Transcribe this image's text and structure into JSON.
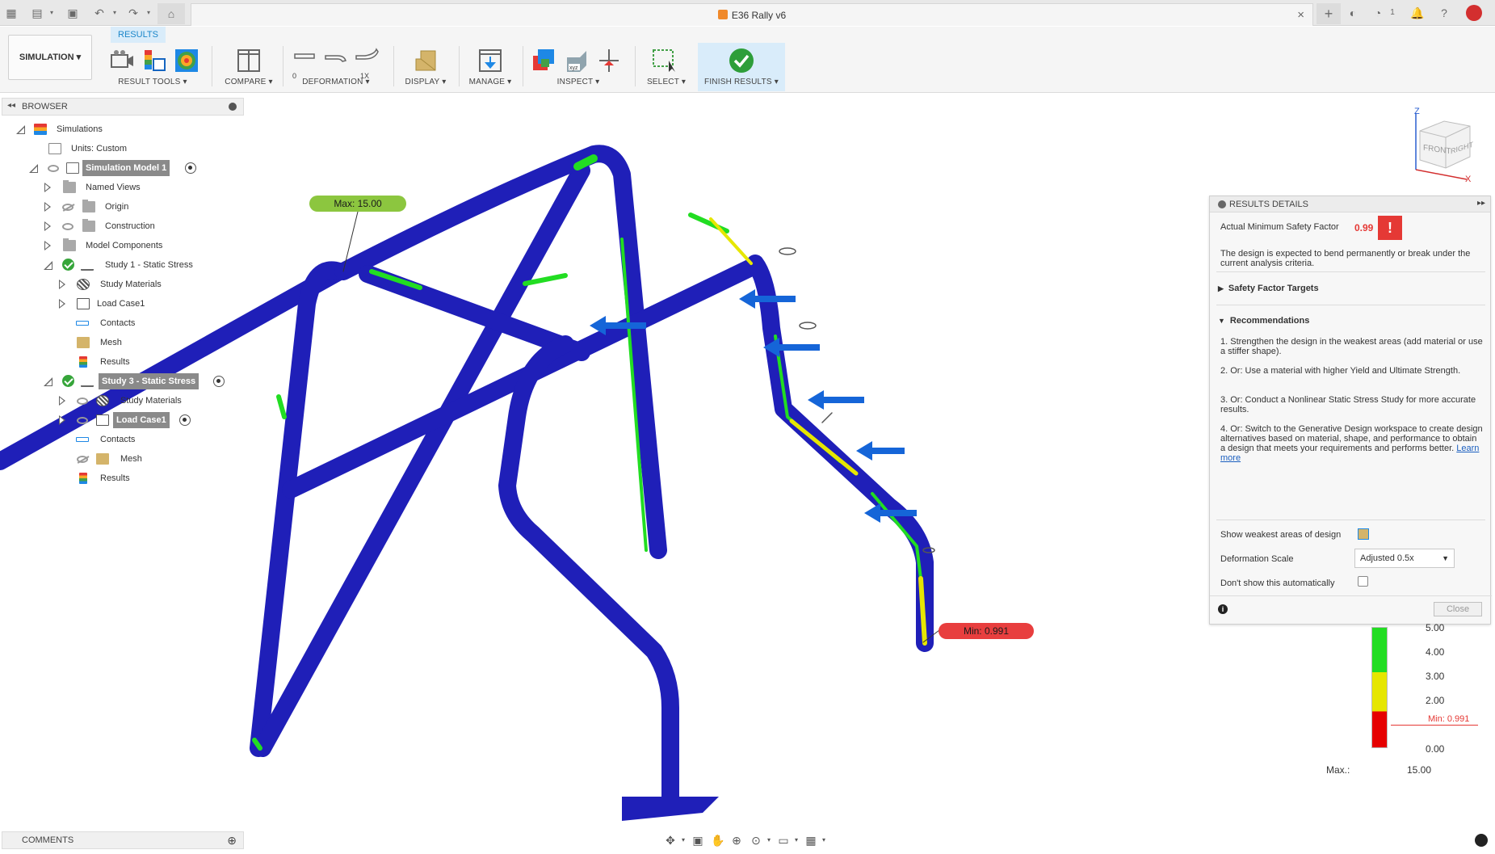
{
  "window": {
    "title": "E36 Rally v6",
    "notification_count": "1"
  },
  "toolbar": {
    "workspace": "SIMULATION",
    "active_tab": "RESULTS",
    "groups": {
      "result_tools": "RESULT TOOLS",
      "compare": "COMPARE",
      "deformation": "DEFORMATION",
      "display": "DISPLAY",
      "manage": "MANAGE",
      "inspect": "INSPECT",
      "select": "SELECT",
      "finish_results": "FINISH RESULTS"
    },
    "deformation_icon_labels": [
      "0",
      "1X"
    ]
  },
  "browser": {
    "title": "BROWSER",
    "items": {
      "simulations": "Simulations",
      "units": "Units: Custom",
      "model": "Simulation Model 1",
      "named_views": "Named Views",
      "origin": "Origin",
      "construction": "Construction",
      "model_components": "Model Components",
      "study1": "Study 1 - Static Stress",
      "study1_materials": "Study Materials",
      "study1_load": "Load Case1",
      "study1_contacts": "Contacts",
      "study1_mesh": "Mesh",
      "study1_results": "Results",
      "study3": "Study 3 - Static Stress",
      "study3_materials": "Study Materials",
      "study3_load": "Load Case1",
      "study3_contacts": "Contacts",
      "study3_mesh": "Mesh",
      "study3_results": "Results"
    }
  },
  "comments": {
    "title": "COMMENTS"
  },
  "viewport": {
    "max_label": "Max: 15.00",
    "min_label": "Min: 0.991",
    "viewcube": {
      "front": "FRONT",
      "right": "RIGHT",
      "axis_z": "Z",
      "axis_x": "X"
    }
  },
  "results_details": {
    "title": "RESULTS DETAILS",
    "min_sf_label": "Actual Minimum Safety Factor",
    "min_sf_value": "0.99",
    "warning_text": "The design is expected to bend permanently or break under the current analysis criteria.",
    "safety_targets": "Safety Factor Targets",
    "recommendations_title": "Recommendations",
    "rec1": "1. Strengthen the design in the weakest areas (add material or use a stiffer shape).",
    "rec2": "2. Or: Use a material with higher Yield and Ultimate Strength.",
    "rec3": "3. Or: Conduct a Nonlinear Static Stress Study for more accurate results.",
    "rec4": "4. Or: Switch to the Generative Design workspace to create design alternatives based on material, shape, and performance to obtain a design that meets your requirements and performs better.",
    "learn_more": "Learn more",
    "show_weakest": "Show weakest areas of design",
    "deformation_scale_label": "Deformation Scale",
    "deformation_scale_value": "Adjusted 0.5x",
    "dont_show": "Don't show this automatically",
    "close": "Close"
  },
  "legend": {
    "ticks": [
      "5.00",
      "4.00",
      "3.00",
      "2.00",
      "0.00"
    ],
    "min_marker": "Min: 0.991",
    "max_label": "Max.:",
    "max_value": "15.00"
  },
  "colors": {
    "tube": "#1f1fb8",
    "stress_green": "#22dd22",
    "stress_yellow": "#e6e600",
    "stress_red": "#e60000",
    "accent_blue": "#1b86c9",
    "max_badge": "#8cc63f",
    "min_badge": "#e83e3e"
  }
}
